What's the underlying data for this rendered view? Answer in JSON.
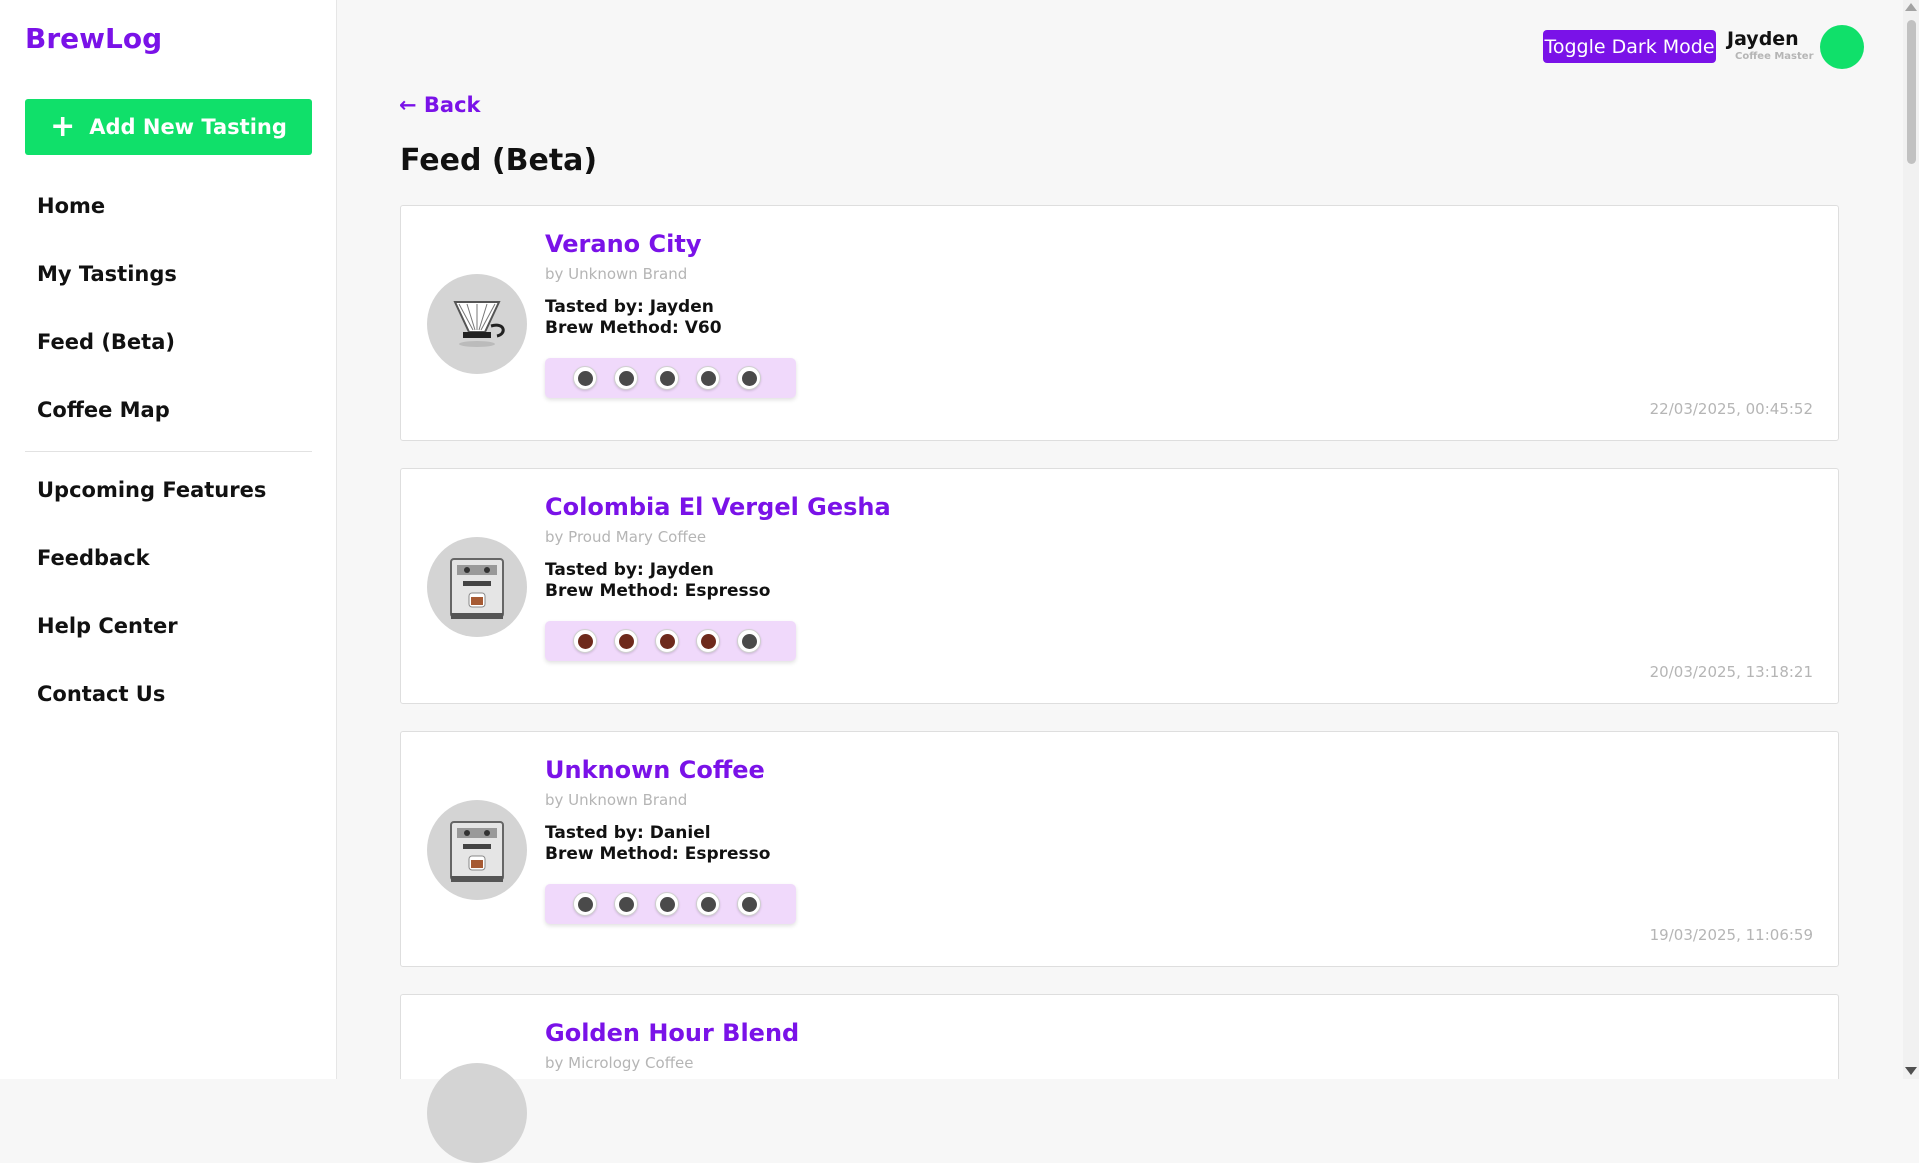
{
  "app": {
    "title": "BrewLog"
  },
  "sidebar": {
    "add_button": {
      "label": "Add New Tasting",
      "icon": "plus-icon"
    },
    "nav_primary": [
      "Home",
      "My Tastings",
      "Feed (Beta)",
      "Coffee Map"
    ],
    "nav_secondary": [
      "Upcoming Features",
      "Feedback",
      "Help Center",
      "Contact Us"
    ]
  },
  "header": {
    "toggle_dark_mode": "Toggle Dark Mode",
    "user": {
      "name": "Jayden",
      "role": "Coffee Master",
      "avatar_color": "#10e06a"
    }
  },
  "main": {
    "back_label": "← Back",
    "title": "Feed (Beta)",
    "feed": [
      {
        "name": "Verano City",
        "brand": "by Unknown Brand",
        "tasted_by": "Tasted by: Jayden",
        "brew_method": "Brew Method: V60",
        "thumbnail": "v60-dripper-icon",
        "rating_filled": 0,
        "timestamp": "22/03/2025, 00:45:52"
      },
      {
        "name": "Colombia El Vergel Gesha",
        "brand": "by Proud Mary Coffee",
        "tasted_by": "Tasted by: Jayden",
        "brew_method": "Brew Method: Espresso",
        "thumbnail": "espresso-machine-icon",
        "rating_filled": 4,
        "timestamp": "20/03/2025, 13:18:21"
      },
      {
        "name": "Unknown Coffee",
        "brand": "by Unknown Brand",
        "tasted_by": "Tasted by: Daniel",
        "brew_method": "Brew Method: Espresso",
        "thumbnail": "espresso-machine-icon",
        "rating_filled": 0,
        "timestamp": "19/03/2025, 11:06:59"
      },
      {
        "name": "Golden Hour Blend",
        "brand": "by Micrology Coffee",
        "tasted_by": "",
        "brew_method": "",
        "thumbnail": "",
        "rating_filled": 0,
        "timestamp": ""
      }
    ]
  },
  "colors": {
    "accent": "#7a12e8",
    "primary_green": "#10e06a",
    "rating_bg": "#f0d9fb",
    "cup_filled": "#6e2a1c",
    "cup_empty": "#4a4a4a"
  }
}
